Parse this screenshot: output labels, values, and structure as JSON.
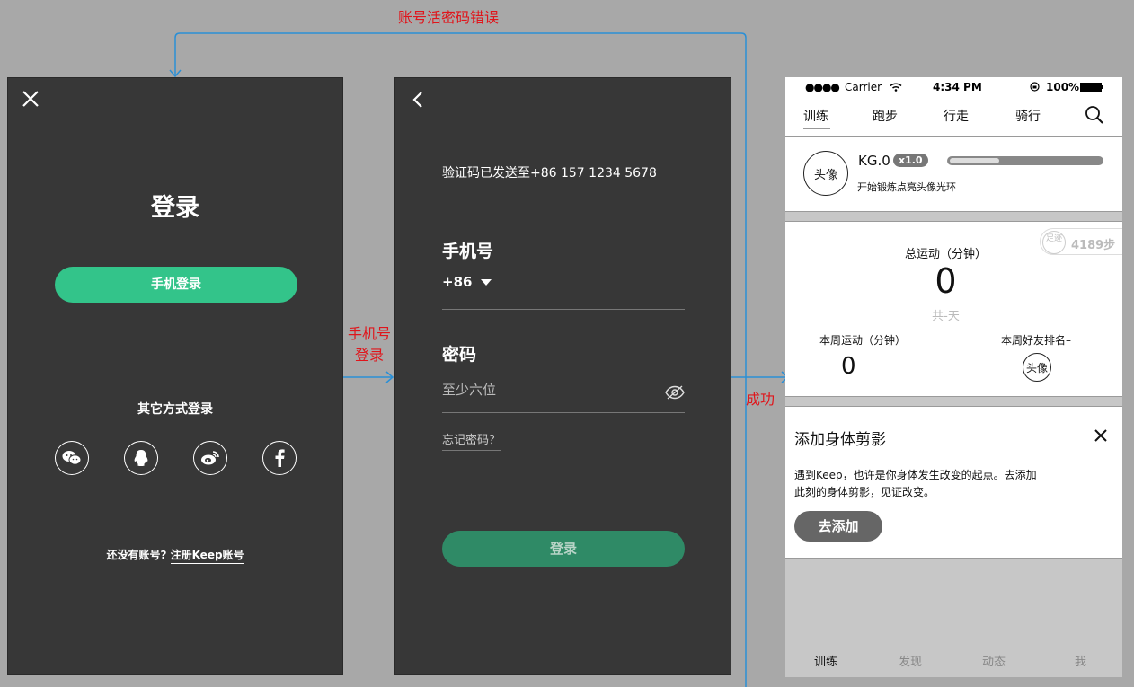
{
  "annotations": {
    "error_label": "账号活密码错误",
    "phone_login_label_line1": "手机号",
    "phone_login_label_line2": "登录",
    "success_label": "成功"
  },
  "screen1": {
    "title": "登录",
    "phone_login_button": "手机登录",
    "other_methods": "其它方式登录",
    "social": [
      "wechat-icon",
      "qq-icon",
      "weibo-icon",
      "facebook-icon"
    ],
    "footer_prefix": "还没有账号?",
    "register_link": "注册Keep账号"
  },
  "screen2": {
    "sent_text": "验证码已发送至+86 157 1234 5678",
    "phone_label": "手机号",
    "country_code": "+86",
    "password_label": "密码",
    "password_placeholder": "至少六位",
    "forgot_password": "忘记密码？",
    "login_button": "登录"
  },
  "screen3": {
    "status": {
      "carrier": "Carrier",
      "time": "4:34 PM",
      "battery": "100%"
    },
    "tabs": [
      "训练",
      "跑步",
      "行走",
      "骑行"
    ],
    "profile": {
      "avatar": "头像",
      "level": "KG.0",
      "multiplier": "x1.0",
      "subtitle": "开始锻炼点亮头像光环",
      "progress": 0.33
    },
    "stats": {
      "footprint_badge": "足迹",
      "steps": "4189步",
      "total_label": "总运动（分钟）",
      "total_value": "0",
      "days": "共-天",
      "week_label": "本周运动（分钟）",
      "week_value": "0",
      "rank_label": "本周好友排名–",
      "rank_avatar": "头像"
    },
    "add_card": {
      "title": "添加身体剪影",
      "body_line1": "遇到Keep，也许是你身体发生改变的起点。去添加",
      "body_line2": "此刻的身体剪影，见证改变。",
      "button": "去添加"
    },
    "bottom_tabs": [
      "训练",
      "发现",
      "动态",
      "我"
    ]
  },
  "colors": {
    "dark_bg": "#373737",
    "accent_green": "#33c48a",
    "connector_blue": "#2a8fd6",
    "annotation_red": "#e0151b"
  }
}
